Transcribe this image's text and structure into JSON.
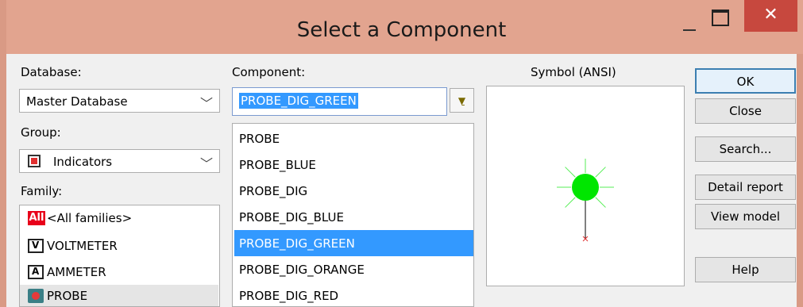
{
  "window": {
    "title": "Select a Component",
    "close_glyph": "✕"
  },
  "database": {
    "label": "Database:",
    "value": "Master Database"
  },
  "group": {
    "label": "Group:",
    "value": "Indicators"
  },
  "family": {
    "label": "Family:",
    "all_badge": "All",
    "items": [
      {
        "label": "<All families>",
        "icon": "all-families-icon"
      },
      {
        "label": "VOLTMETER",
        "icon": "voltmeter-icon"
      },
      {
        "label": "AMMETER",
        "icon": "ammeter-icon"
      },
      {
        "label": "PROBE",
        "icon": "probe-icon"
      }
    ]
  },
  "component": {
    "label": "Component:",
    "input_value": "PROBE_DIG_GREEN",
    "items": [
      "PROBE",
      "PROBE_BLUE",
      "PROBE_DIG",
      "PROBE_DIG_BLUE",
      "PROBE_DIG_GREEN",
      "PROBE_DIG_ORANGE",
      "PROBE_DIG_RED"
    ],
    "selected_index": 4
  },
  "symbol": {
    "label": "Symbol (ANSI)",
    "probe_color": "#00e600",
    "ray_color": "#55ee55",
    "pin_marker_color": "#e03030"
  },
  "buttons": {
    "ok": "OK",
    "close": "Close",
    "search": "Search...",
    "detail_report": "Detail report",
    "view_model": "View model",
    "help": "Help"
  },
  "colors": {
    "titlebar": "#e2a48f",
    "close_button": "#c7483e",
    "selection": "#3399ff"
  }
}
